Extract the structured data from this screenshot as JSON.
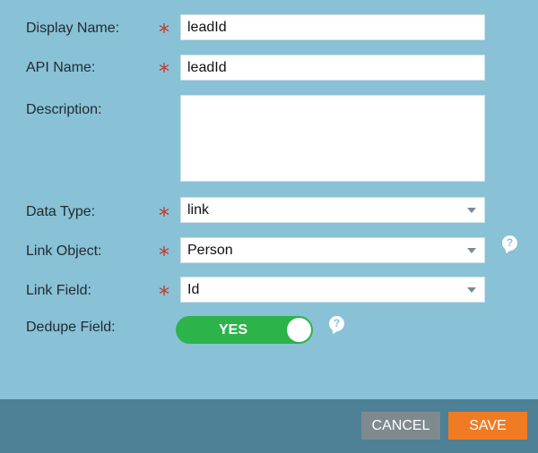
{
  "form": {
    "display_name": {
      "label": "Display Name:",
      "value": "leadId",
      "required": true
    },
    "api_name": {
      "label": "API Name:",
      "value": "leadId",
      "required": true
    },
    "description": {
      "label": "Description:",
      "value": ""
    },
    "data_type": {
      "label": "Data Type:",
      "value": "link",
      "required": true
    },
    "link_object": {
      "label": "Link Object:",
      "value": "Person",
      "required": true
    },
    "link_field": {
      "label": "Link Field:",
      "value": "Id",
      "required": true
    },
    "dedupe_field": {
      "label": "Dedupe Field:",
      "toggle_label": "YES",
      "on": true
    }
  },
  "icons": {
    "required_marker": "*",
    "help_glyph": "?"
  },
  "footer": {
    "cancel_label": "CANCEL",
    "save_label": "SAVE"
  },
  "colors": {
    "background": "#89c1d6",
    "footer": "#4e8096",
    "toggle_on": "#2cb34a",
    "save": "#f07b22",
    "cancel": "#7f8a8e",
    "required": "#c0392b"
  }
}
